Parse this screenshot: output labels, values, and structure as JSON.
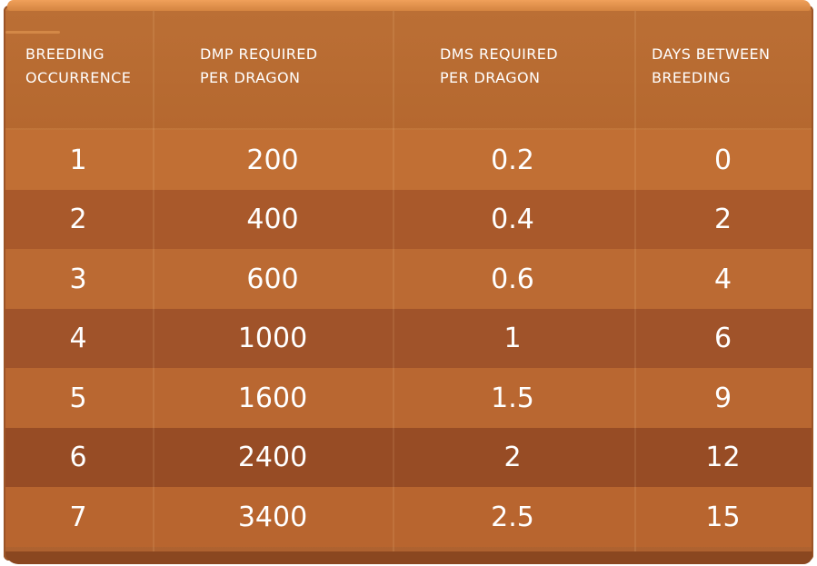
{
  "table": {
    "headers": [
      [
        "BREEDING",
        "OCCURRENCE"
      ],
      [
        "DMP REQUIRED",
        "PER DRAGON"
      ],
      [
        "DMS REQUIRED",
        "PER DRAGON"
      ],
      [
        "DAYS BETWEEN",
        "BREEDING"
      ]
    ],
    "rows": [
      [
        "1",
        "200",
        "0.2",
        "0"
      ],
      [
        "2",
        "400",
        "0.4",
        "2"
      ],
      [
        "3",
        "600",
        "0.6",
        "4"
      ],
      [
        "4",
        "1000",
        "1",
        "6"
      ],
      [
        "5",
        "1600",
        "1.5",
        "9"
      ],
      [
        "6",
        "2400",
        "2",
        "12"
      ],
      [
        "7",
        "3400",
        "2.5",
        "15"
      ]
    ],
    "row_colors": [
      "#c16f34",
      "#a9592b",
      "#bb6a33",
      "#a0532a",
      "#b96731",
      "#974c25",
      "#b8652f"
    ]
  }
}
